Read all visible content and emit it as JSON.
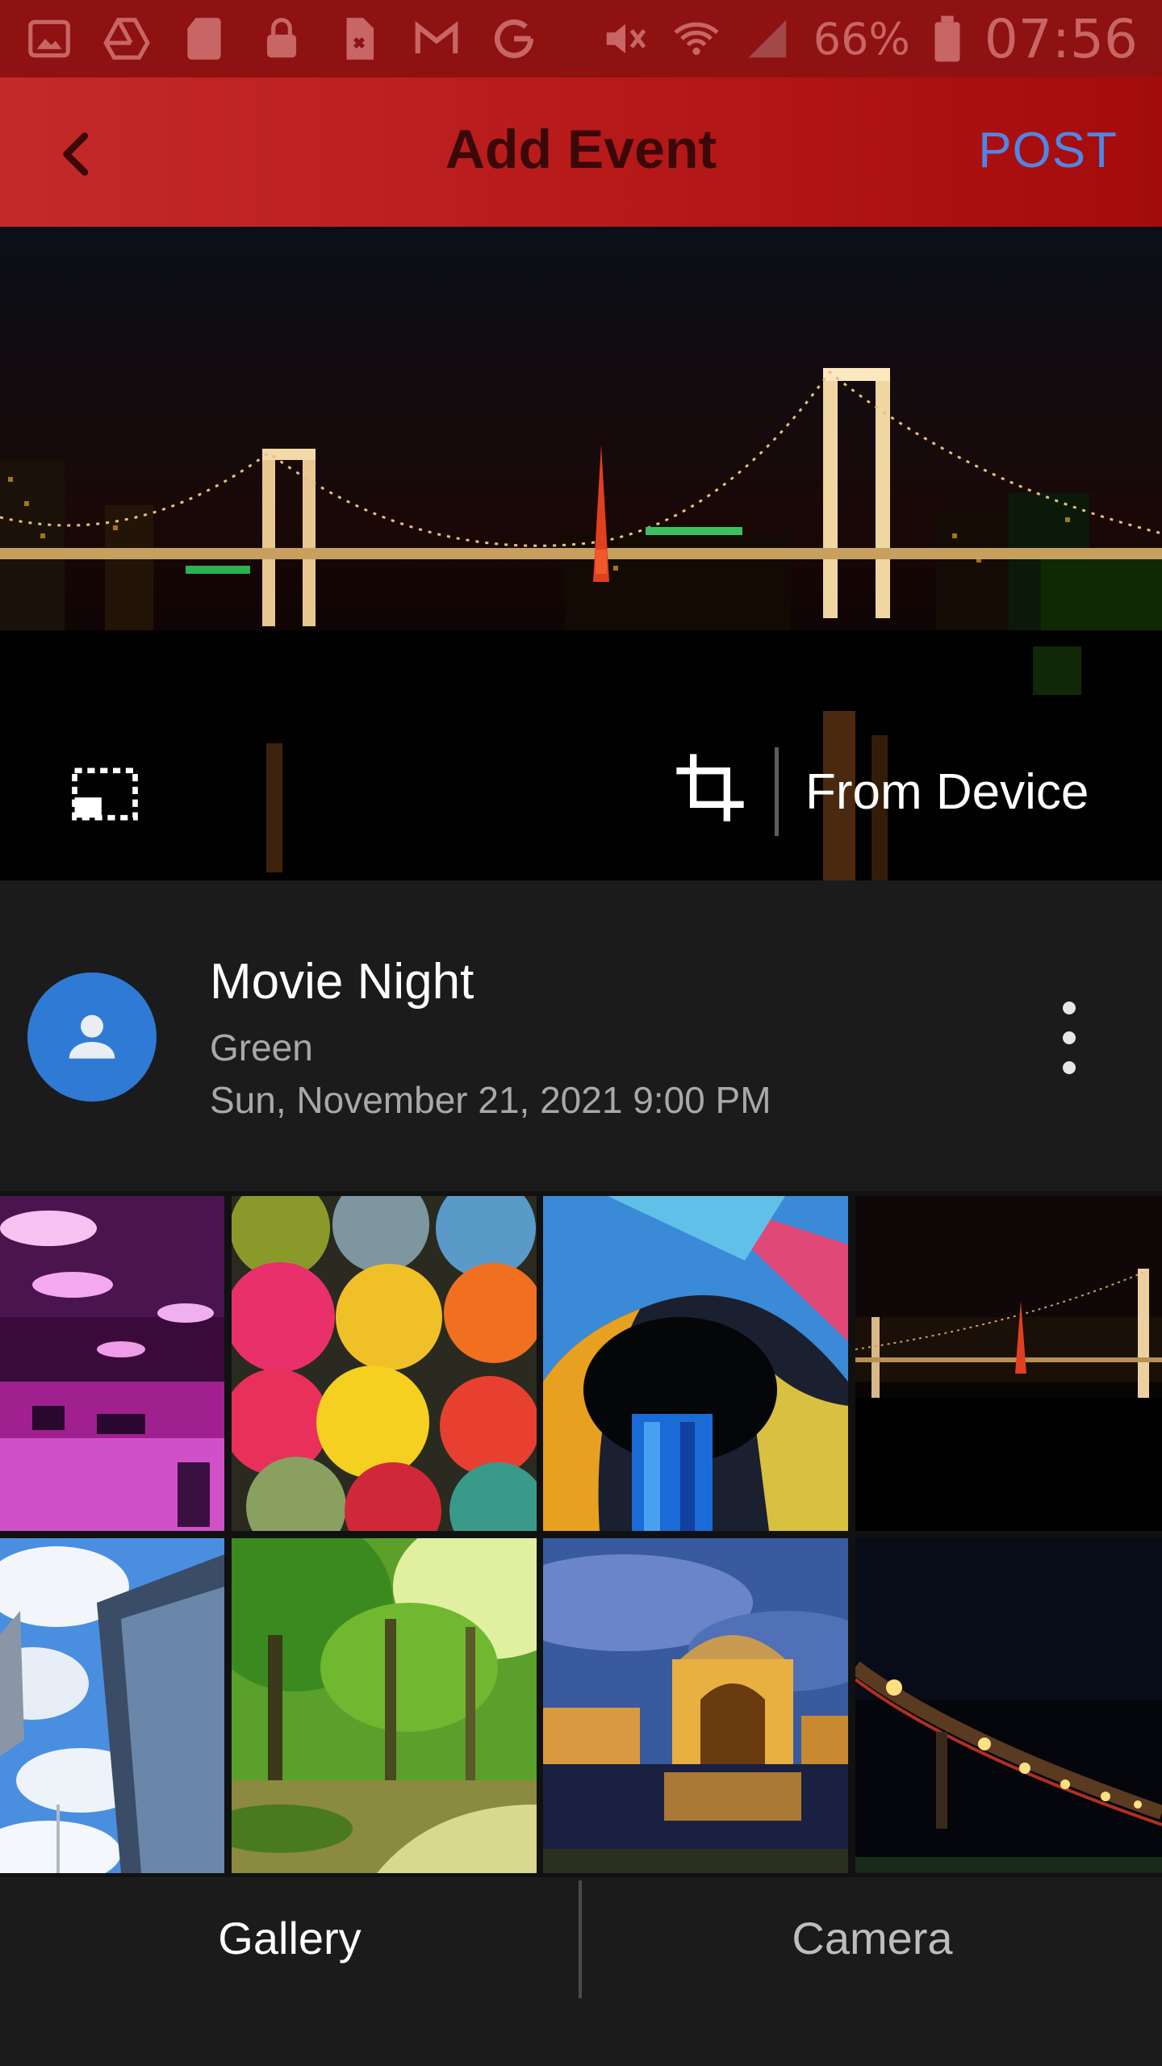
{
  "status_bar": {
    "battery_percent": "66%",
    "time": "07:56",
    "icons": [
      "gallery-icon",
      "drive-icon",
      "sd-card-icon",
      "lock-icon",
      "file-icon",
      "gmail-icon",
      "google-icon",
      "mute-icon",
      "wifi-icon",
      "signal-icon",
      "battery-icon"
    ]
  },
  "app_bar": {
    "title": "Add Event",
    "post_label": "POST",
    "back_icon": "back-arrow-icon"
  },
  "preview": {
    "source_label": "From Device",
    "icons": [
      "aspect-ratio-icon",
      "crop-icon"
    ]
  },
  "event": {
    "title": "Movie Night",
    "subtitle": "Green",
    "datetime": "Sun, November 21, 2021 9:00 PM",
    "avatar_icon": "person-icon",
    "menu_icon": "more-vert-icon"
  },
  "gallery": {
    "thumbnails": [
      "purple-event-hall",
      "yarn-balls",
      "stained-glass-dome",
      "night-bridge",
      "skyscraper-sky",
      "green-forest",
      "palace-at-dusk",
      "night-bridge-lights"
    ]
  },
  "tabs": {
    "gallery": "Gallery",
    "camera": "Camera",
    "active": "Gallery"
  },
  "colors": {
    "app_bar": "#b81a1a",
    "status_bar": "#8e1212",
    "post_accent": "#4f86e6",
    "avatar": "#2f7ad4",
    "background": "#161616"
  }
}
